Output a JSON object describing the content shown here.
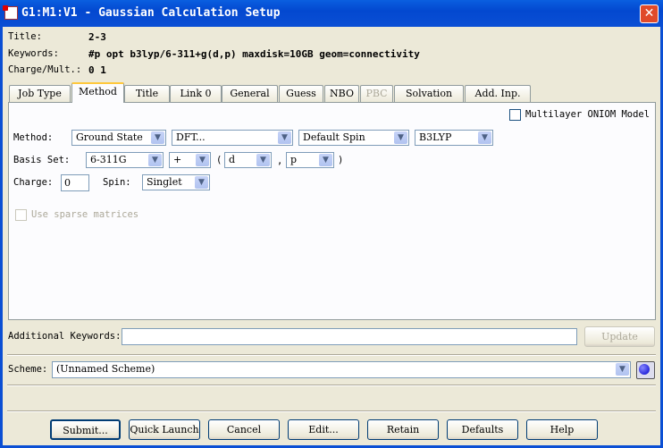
{
  "window": {
    "title": "G1:M1:V1 - Gaussian Calculation Setup",
    "close": "✕"
  },
  "header": {
    "title_label": "Title:",
    "title_value": "2-3",
    "keywords_label": "Keywords:",
    "keywords_value": "#p opt b3lyp/6-311+g(d,p) maxdisk=10GB geom=connectivity",
    "charge_label": "Charge/Mult.:",
    "charge_value": "0 1"
  },
  "tabs": [
    {
      "label": "Job Type"
    },
    {
      "label": "Method"
    },
    {
      "label": "Title"
    },
    {
      "label": "Link 0"
    },
    {
      "label": "General"
    },
    {
      "label": "Guess"
    },
    {
      "label": "NBO"
    },
    {
      "label": "PBC"
    },
    {
      "label": "Solvation"
    },
    {
      "label": "Add. Inp."
    }
  ],
  "method": {
    "oniom_label": "Multilayer ONIOM Model",
    "method_label": "Method:",
    "state": "Ground State",
    "type": "DFT...",
    "spin_mode": "Default Spin",
    "functional": "B3LYP",
    "basis_label": "Basis Set:",
    "basis": "6-311G",
    "diffuse": "+",
    "open_paren": "(",
    "polar_heavy": "d",
    "comma": ",",
    "polar_h": "p",
    "close_paren": ")",
    "charge_label": "Charge:",
    "charge": "0",
    "spin_label": "Spin:",
    "spin": "Singlet",
    "sparse_label": "Use sparse matrices"
  },
  "additional": {
    "label": "Additional Keywords:",
    "value": "",
    "update": "Update"
  },
  "scheme": {
    "label": "Scheme:",
    "value": "(Unnamed Scheme)"
  },
  "buttons": {
    "submit": "Submit...",
    "quick": "Quick Launch",
    "cancel": "Cancel",
    "edit": "Edit...",
    "retain": "Retain",
    "defaults": "Defaults",
    "help": "Help"
  }
}
